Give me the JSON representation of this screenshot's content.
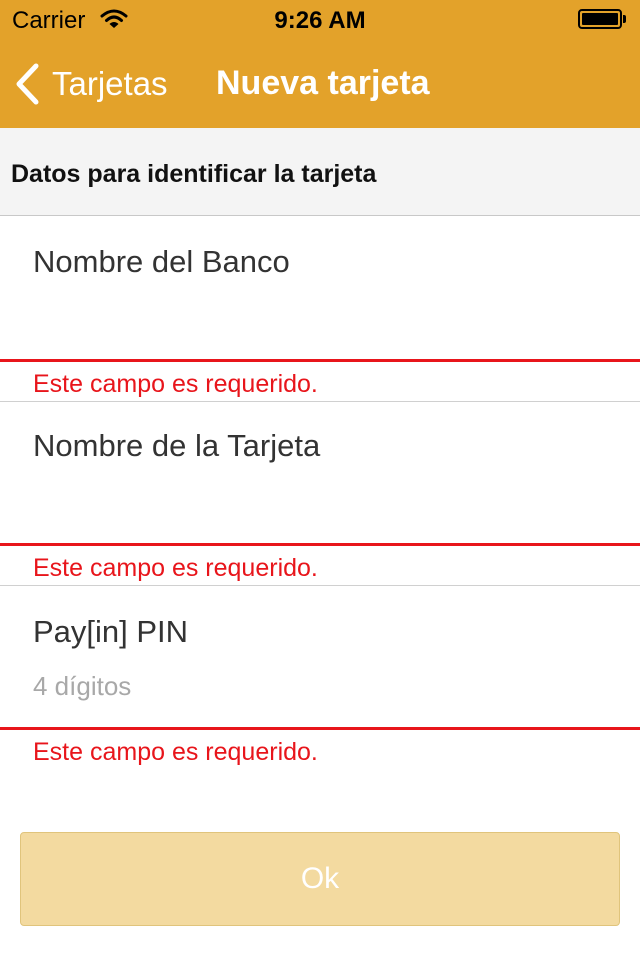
{
  "status_bar": {
    "carrier": "Carrier",
    "time": "9:26 AM"
  },
  "nav": {
    "back_label": "Tarjetas",
    "title": "Nueva tarjeta"
  },
  "section": {
    "header": "Datos para identificar la tarjeta"
  },
  "fields": [
    {
      "label": "Nombre del Banco",
      "value": "",
      "placeholder": "",
      "error": "Este campo es requerido."
    },
    {
      "label": "Nombre de la Tarjeta",
      "value": "",
      "placeholder": "",
      "error": "Este campo es requerido."
    },
    {
      "label": "Pay[in] PIN",
      "value": "",
      "placeholder": "4 dígitos",
      "error": "Este campo es requerido."
    }
  ],
  "ok_button": {
    "label": "Ok",
    "enabled": false
  },
  "colors": {
    "nav_bar": "#e3a22a",
    "error": "#e8151b",
    "button_disabled": "#f3daa0"
  },
  "icons": {
    "back": "chevron-left-icon",
    "wifi": "wifi-icon",
    "battery": "battery-icon"
  }
}
